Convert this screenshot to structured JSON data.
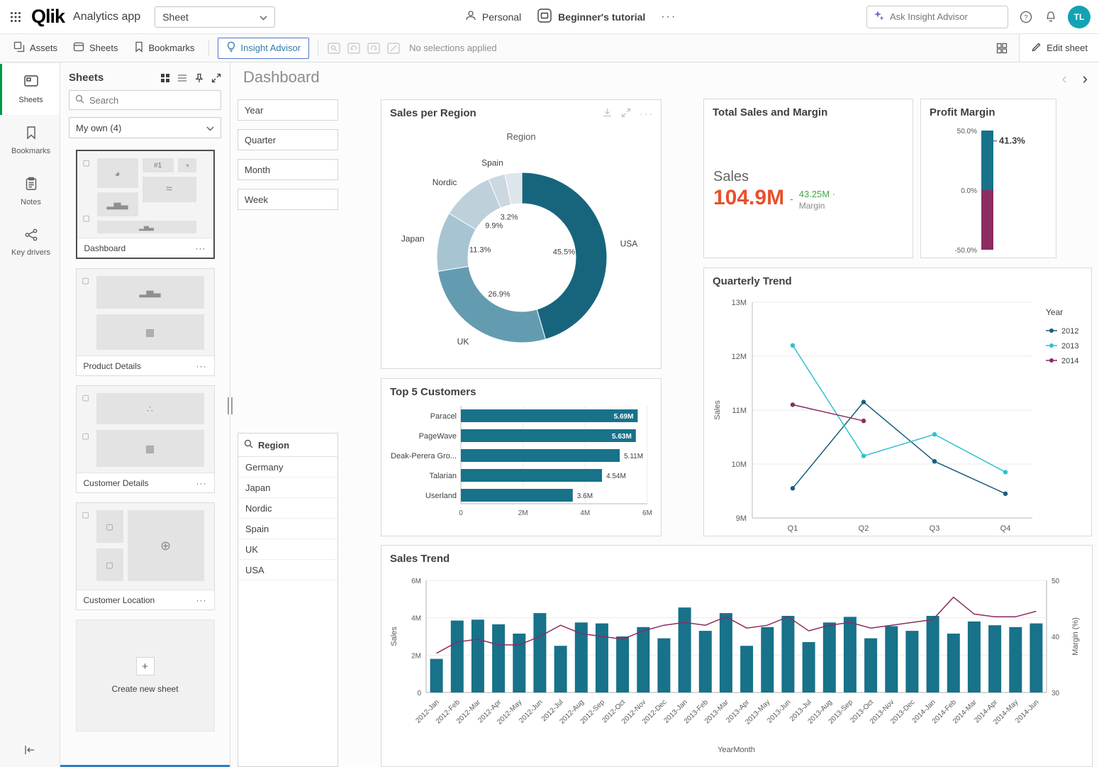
{
  "header": {
    "logo": "Qlik",
    "app_title": "Analytics app",
    "sheet_selector": "Sheet",
    "personal": "Personal",
    "tutorial": "Beginner's tutorial",
    "insight_placeholder": "Ask Insight Advisor",
    "avatar_initials": "TL"
  },
  "toolbar": {
    "assets": "Assets",
    "sheets": "Sheets",
    "bookmarks": "Bookmarks",
    "insight_advisor": "Insight Advisor",
    "no_selections": "No selections applied",
    "edit_sheet": "Edit sheet"
  },
  "rail": {
    "items": [
      "Sheets",
      "Bookmarks",
      "Notes",
      "Key drivers"
    ]
  },
  "sheets_panel": {
    "title": "Sheets",
    "search_placeholder": "Search",
    "collection_filter": "My own (4)",
    "sheets": [
      "Dashboard",
      "Product Details",
      "Customer Details",
      "Customer Location"
    ],
    "create_new": "Create new sheet"
  },
  "main": {
    "title": "Dashboard",
    "filters": [
      "Year",
      "Quarter",
      "Month",
      "Week"
    ],
    "region_filter": {
      "title": "Region",
      "items": [
        "Germany",
        "Japan",
        "Nordic",
        "Spain",
        "UK",
        "USA"
      ]
    }
  },
  "icons": {
    "pie": "◕",
    "gauge": "◔",
    "rank": "#1",
    "bars": "▂▅▃",
    "line": "≈",
    "table": "▦",
    "scatter": "∴",
    "globe": "⊕",
    "box": "▢",
    "plus": "+",
    "more": "···",
    "prev": "‹",
    "next": "›"
  },
  "colors": {
    "teal": "#17728a",
    "navy": "#1a5d7d",
    "cyan": "#30c1cf",
    "magenta": "#8c2c62",
    "kpi_red": "#e8502d",
    "kpi_green": "#3faa44",
    "green_accent": "#009845"
  },
  "chart_data": [
    {
      "id": "sales_per_region",
      "type": "pie",
      "title": "Sales per Region",
      "dimension_label": "Region",
      "slices": [
        {
          "label": "USA",
          "value": 45.5,
          "color": "#17657d"
        },
        {
          "label": "UK",
          "value": 26.9,
          "color": "#639cb0"
        },
        {
          "label": "Japan",
          "value": 11.3,
          "color": "#a7c4d3"
        },
        {
          "label": "Nordic",
          "value": 9.9,
          "color": "#bed0da"
        },
        {
          "label": "Spain",
          "value": 3.2,
          "color": "#cbd8e0"
        },
        {
          "label": "",
          "value": 3.2,
          "color": "#dde6ec"
        }
      ]
    },
    {
      "id": "total_sales_margin",
      "type": "kpi",
      "title": "Total Sales and Margin",
      "label": "Sales",
      "value": "104.9M",
      "separator": "-",
      "secondary_value": "43.25M ·",
      "secondary_label": "Margin"
    },
    {
      "id": "profit_margin",
      "type": "gauge",
      "title": "Profit Margin",
      "value": 41.3,
      "value_label": "41.3%",
      "min": -50,
      "max": 50,
      "ticks": [
        "50.0%",
        "0.0%",
        "-50.0%"
      ],
      "colors": {
        "positive": "#17728a",
        "negative": "#8c2c62"
      }
    },
    {
      "id": "quarterly_trend",
      "type": "line",
      "title": "Quarterly Trend",
      "ylabel": "Sales",
      "legend_title": "Year",
      "categories": [
        "Q1",
        "Q2",
        "Q3",
        "Q4"
      ],
      "ylim": [
        9,
        13
      ],
      "ytick_labels": [
        "9M",
        "10M",
        "11M",
        "12M",
        "13M"
      ],
      "series": [
        {
          "name": "2012",
          "color": "#1a5d7d",
          "values": [
            9.55,
            11.15,
            10.05,
            9.45
          ]
        },
        {
          "name": "2013",
          "color": "#30c1cf",
          "values": [
            12.2,
            10.15,
            10.55,
            9.85
          ]
        },
        {
          "name": "2014",
          "color": "#8c2c62",
          "values": [
            11.1,
            10.8,
            null,
            null
          ]
        }
      ]
    },
    {
      "id": "top_customers",
      "type": "bar",
      "title": "Top 5 Customers",
      "categories": [
        "Paracel",
        "PageWave",
        "Deak-Perera Gro...",
        "Talarian",
        "Userland"
      ],
      "values": [
        5.69,
        5.63,
        5.11,
        4.54,
        3.6
      ],
      "value_labels": [
        "5.69M",
        "5.63M",
        "5.11M",
        "4.54M",
        "3.6M"
      ],
      "xlim": [
        0,
        6
      ],
      "xticks": [
        "0",
        "2M",
        "4M",
        "6M"
      ],
      "color": "#17728a"
    },
    {
      "id": "sales_trend",
      "type": "combo",
      "title": "Sales Trend",
      "xlabel": "YearMonth",
      "ylabel_left": "Sales",
      "ylabel_right": "Margin (%)",
      "ylim_left": [
        0,
        6
      ],
      "ylim_right": [
        30,
        50
      ],
      "yticks_left": [
        "0",
        "2M",
        "4M",
        "6M"
      ],
      "yticks_right": [
        "30",
        "40",
        "50"
      ],
      "categories": [
        "2012-Jan",
        "2012-Feb",
        "2012-Mar",
        "2012-Apr",
        "2012-May",
        "2012-Jun",
        "2012-Jul",
        "2012-Aug",
        "2012-Sep",
        "2012-Oct",
        "2012-Nov",
        "2012-Dec",
        "2013-Jan",
        "2013-Feb",
        "2013-Mar",
        "2013-Apr",
        "2013-May",
        "2013-Jun",
        "2013-Jul",
        "2013-Aug",
        "2013-Sep",
        "2013-Oct",
        "2013-Nov",
        "2013-Dec",
        "2014-Jan",
        "2014-Feb",
        "2014-Mar",
        "2014-Apr",
        "2014-May",
        "2014-Jun"
      ],
      "bars": {
        "name": "Sales",
        "color": "#17728a",
        "values": [
          1.8,
          3.85,
          3.9,
          3.65,
          3.15,
          4.25,
          2.5,
          3.75,
          3.7,
          3.0,
          3.5,
          2.9,
          4.55,
          3.3,
          4.25,
          2.5,
          3.5,
          4.1,
          2.7,
          3.75,
          4.05,
          2.9,
          3.55,
          3.3,
          4.1,
          3.15,
          3.8,
          3.6,
          3.5,
          3.7
        ]
      },
      "line": {
        "name": "Margin",
        "color": "#8c2c62",
        "values": [
          37,
          39,
          39.5,
          38.5,
          38.5,
          40,
          42,
          40.5,
          40,
          39.5,
          41,
          42,
          42.5,
          42,
          43.5,
          41.5,
          42,
          43.5,
          41,
          42,
          42.5,
          41.5,
          42,
          42.5,
          43,
          47,
          44,
          43.5,
          43.5,
          44.5
        ]
      }
    }
  ]
}
